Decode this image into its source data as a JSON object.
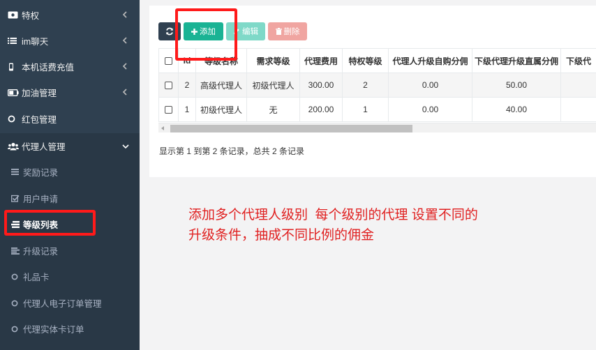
{
  "sidebar": {
    "items": [
      {
        "label": "特权",
        "icon": "ticket-icon"
      },
      {
        "label": "im聊天",
        "icon": "list-icon"
      },
      {
        "label": "本机话费充值",
        "icon": "mobile-icon"
      },
      {
        "label": "加油管理",
        "icon": "battery-icon"
      },
      {
        "label": "红包管理",
        "icon": "circle-icon"
      },
      {
        "label": "代理人管理",
        "icon": "users-icon"
      }
    ],
    "sub_items": [
      {
        "label": "奖励记录",
        "icon": "bars-icon"
      },
      {
        "label": "用户申请",
        "icon": "checkbox-icon"
      },
      {
        "label": "等级列表",
        "icon": "tasks-icon"
      },
      {
        "label": "升级记录",
        "icon": "align-icon"
      },
      {
        "label": "礼品卡",
        "icon": "circle-icon"
      },
      {
        "label": "代理人电子订单管理",
        "icon": "circle-icon"
      },
      {
        "label": "代理实体卡订单",
        "icon": "circle-icon"
      }
    ]
  },
  "toolbar": {
    "add_label": "添加",
    "edit_label": "编辑",
    "delete_label": "删除"
  },
  "table": {
    "columns": [
      "Id",
      "等级名称",
      "需求等级",
      "代理费用",
      "特权等级",
      "代理人升级自购分佣",
      "下级代理升级直属分佣",
      "下级代"
    ],
    "rows": [
      [
        "2",
        "高级代理人",
        "初级代理人",
        "300.00",
        "2",
        "0.00",
        "50.00",
        ""
      ],
      [
        "1",
        "初级代理人",
        "无",
        "200.00",
        "1",
        "0.00",
        "40.00",
        ""
      ]
    ]
  },
  "summary": "显示第 1 到第 2 条记录，总共 2 条记录",
  "annotation": {
    "line1": "添加多个代理人级别  每个级别的代理 设置不同的",
    "line2": "升级条件，抽成不同比例的佣金"
  },
  "colors": {
    "sidebar_bg": "#2f4050",
    "sidebar_active_bg": "#293846",
    "add_button": "#1ab394",
    "edit_button": "#7fd9c8",
    "delete_button": "#f0a5a1",
    "annotation_red": "#e02020"
  }
}
